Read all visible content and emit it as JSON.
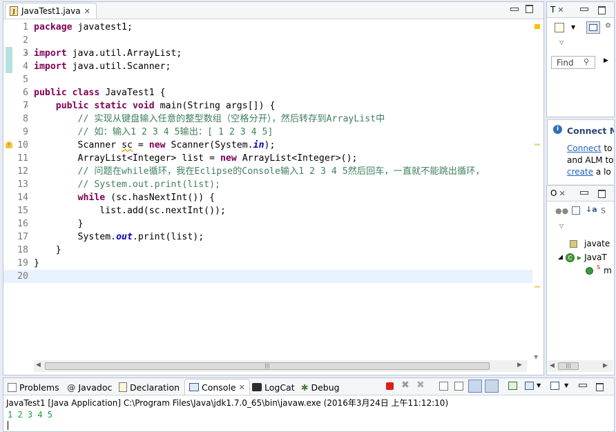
{
  "editor": {
    "tab_label": "JavaTest1.java",
    "lines": [
      {
        "n": "1",
        "html": "<span class=\"kw\">package</span> javatest1;"
      },
      {
        "n": "2",
        "html": ""
      },
      {
        "n": "3",
        "html": "<span class=\"kw\">import</span> java.util.ArrayList;"
      },
      {
        "n": "4",
        "html": "<span class=\"kw\">import</span> java.util.Scanner;"
      },
      {
        "n": "5",
        "html": ""
      },
      {
        "n": "6",
        "html": "<span class=\"kw\">public</span> <span class=\"kw\">class</span> JavaTest1 {"
      },
      {
        "n": "7",
        "html": "    <span class=\"kw\">public</span> <span class=\"kw\">static</span> <span class=\"kw\">void</span> main(String args[]) {"
      },
      {
        "n": "8",
        "html": "        <span class=\"cm\">// 实现从键盘输入任意的整型数组（空格分开），然后转存到ArrayList中</span>"
      },
      {
        "n": "9",
        "html": "        <span class=\"cm\">// 如：输入1 2 3 4 5输出：[ 1 2 3 4 5]</span>"
      },
      {
        "n": "10",
        "html": "        Scanner <span style=\"text-decoration:underline wavy #d8a400\">sc</span> = <span class=\"kw\">new</span> Scanner(System.<span class=\"fld\">in</span>);"
      },
      {
        "n": "11",
        "html": "        ArrayList&lt;Integer&gt; list = <span class=\"kw\">new</span> ArrayList&lt;Integer&gt;();"
      },
      {
        "n": "12",
        "html": "        <span class=\"cm\">// 问题在while循环，我在Eclipse的Console输入1 2 3 4 5然后回车，一直就不能跳出循环，</span>"
      },
      {
        "n": "13",
        "html": "        <span class=\"cm\">// System.out.print(list);</span>"
      },
      {
        "n": "14",
        "html": "        <span class=\"kw\">while</span> (sc.hasNextInt()) {"
      },
      {
        "n": "15",
        "html": "            list.add(sc.nextInt());"
      },
      {
        "n": "16",
        "html": "        }"
      },
      {
        "n": "17",
        "html": "        System.<span class=\"fld\">out</span>.print(list);"
      },
      {
        "n": "18",
        "html": "    }"
      },
      {
        "n": "19",
        "html": "}"
      },
      {
        "n": "20",
        "html": ""
      }
    ]
  },
  "task_panel": {
    "tab_label": "T",
    "find_placeholder": "Find",
    "connect_title": "Connect M",
    "connect_line1_link": "Connect",
    "connect_line1_rest": " to",
    "connect_line2": "and ALM to",
    "connect_line3_link": "create",
    "connect_line3_rest": " a lo"
  },
  "outline_panel": {
    "tab_label": "O",
    "items": [
      "javate",
      "JavaT",
      "m"
    ]
  },
  "bottom": {
    "tabs": [
      "Problems",
      "Javadoc",
      "Declaration",
      "Console",
      "LogCat",
      "Debug"
    ],
    "console_header": "JavaTest1 [Java Application] C:\\Program Files\\Java\\jdk1.7.0_65\\bin\\javaw.exe (2016年3月24日 上午11:12:10)",
    "console_output": "1 2 3 4 5"
  }
}
